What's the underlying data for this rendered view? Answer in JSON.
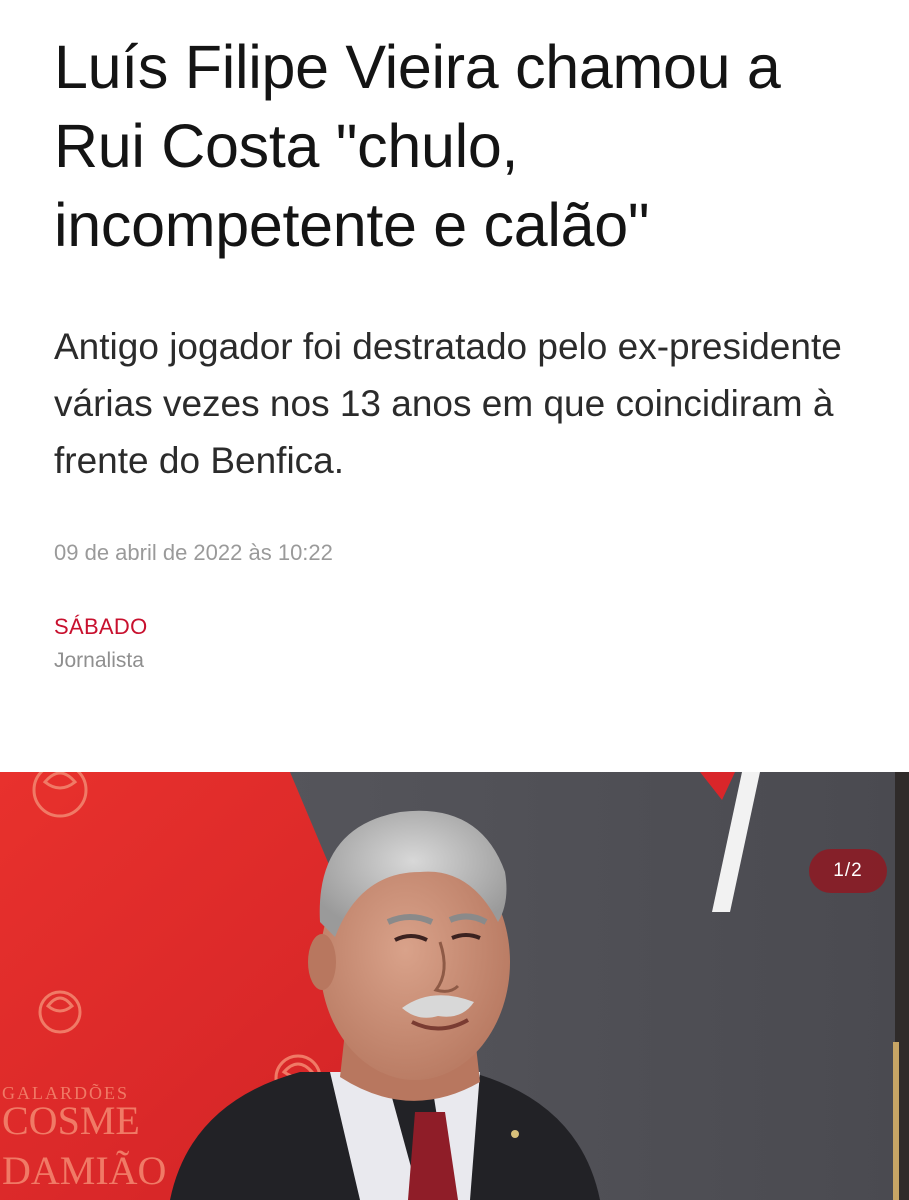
{
  "article": {
    "headline": "Luís Filipe Vieira chamou a Rui Costa \"chulo, incompetente e calão\"",
    "subtitle": "Antigo jogador foi destratado pelo ex-presidente várias vezes nos 13 anos em que coincidiram à frente do Benfica.",
    "date": "09 de abril de 2022 às 10:22",
    "source": "SÁBADO",
    "role": "Jornalista"
  },
  "gallery": {
    "counter": "1/2",
    "wall_text": {
      "line1": "GALARDÕES",
      "line2": "COSME",
      "line3": "DAMIÃO"
    }
  },
  "colors": {
    "accent": "#c8102e",
    "backdrop_red": "#e02a28",
    "backdrop_gray": "#56565c"
  }
}
